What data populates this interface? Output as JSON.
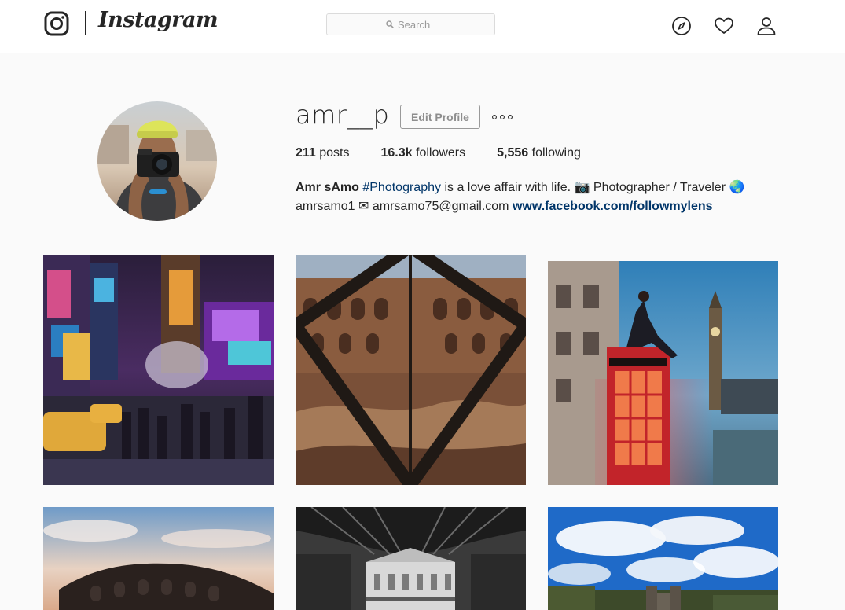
{
  "nav": {
    "wordmark": "Instagram",
    "search_placeholder": "Search",
    "icons": [
      "instagram-logo-icon",
      "compass-icon",
      "heart-icon",
      "person-icon",
      "search-icon"
    ]
  },
  "profile": {
    "username": "amr__p",
    "edit_label": "Edit Profile",
    "more_label": "ooo",
    "stats": {
      "posts_count": "211",
      "posts_label": " posts",
      "followers_count": "16.3k",
      "followers_label": " followers",
      "following_count": "5,556",
      "following_label": " following"
    },
    "bio": {
      "name": "Amr sAmo",
      "hashtag": "#Photography",
      "text_1": " is a love affair with life. 📷 Photographer / Traveler 🌏",
      "text_2": "amrsamo1 ✉ amrsamo75@gmail.com ",
      "link": "www.facebook.com/followmylens"
    }
  },
  "colors": {
    "border": "#dbdbdb",
    "link": "#003569",
    "text": "#262626",
    "muted": "#999999"
  }
}
